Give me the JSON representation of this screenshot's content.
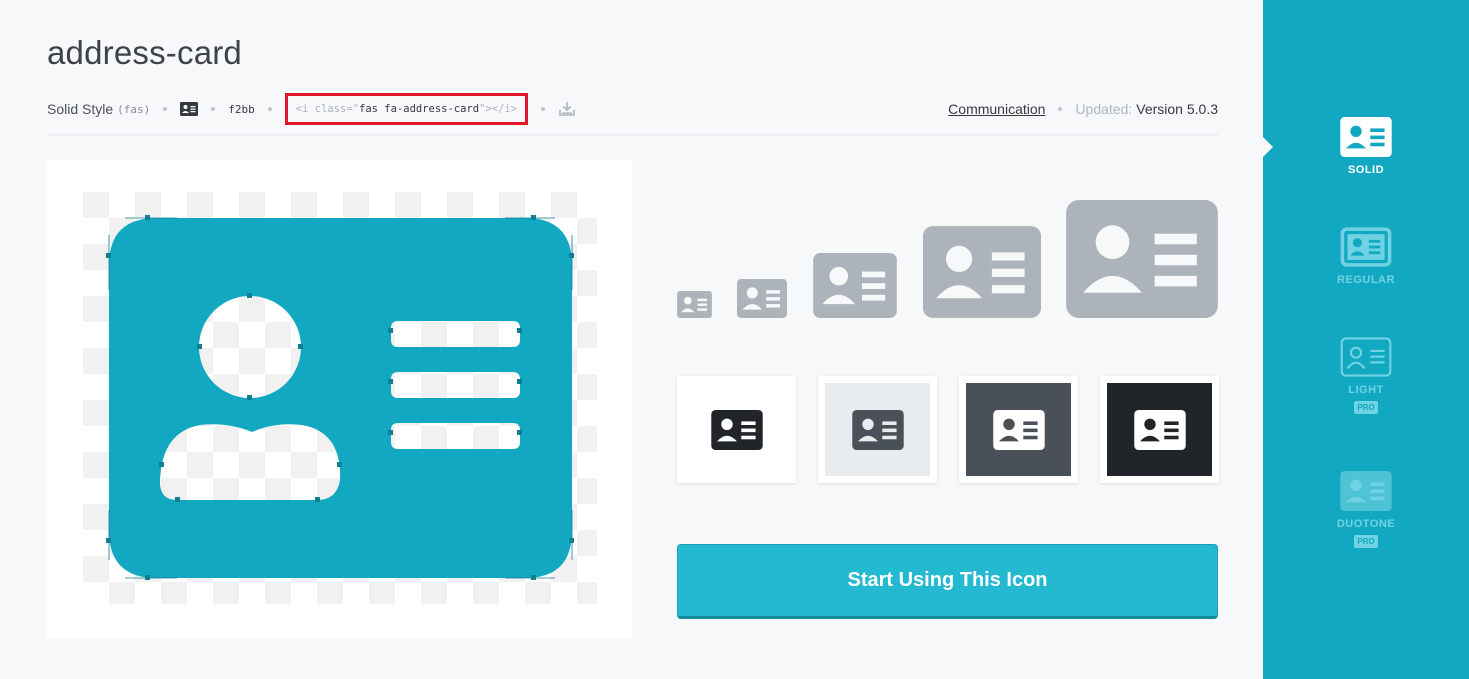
{
  "header": {
    "title": "address-card",
    "style_label": "Solid Style",
    "style_prefix": "(fas)",
    "unicode": "f2bb",
    "code_open": "<i class=\"",
    "code_class": "fas fa-address-card",
    "code_close": "\"></i>",
    "category": "Communication",
    "updated_label": "Updated:",
    "version": "Version 5.0.3"
  },
  "cta": {
    "label": "Start Using This Icon"
  },
  "sidebar": {
    "items": [
      {
        "label": "SOLID",
        "pro": ""
      },
      {
        "label": "REGULAR",
        "pro": ""
      },
      {
        "label": "LIGHT",
        "pro": "PRO"
      },
      {
        "label": "DUOTONE",
        "pro": "PRO"
      }
    ]
  },
  "colors": {
    "accent": "#13a8c2",
    "button": "#23b9d1",
    "icon_gray": "#adb3ba",
    "highlight": "#e0172b"
  }
}
